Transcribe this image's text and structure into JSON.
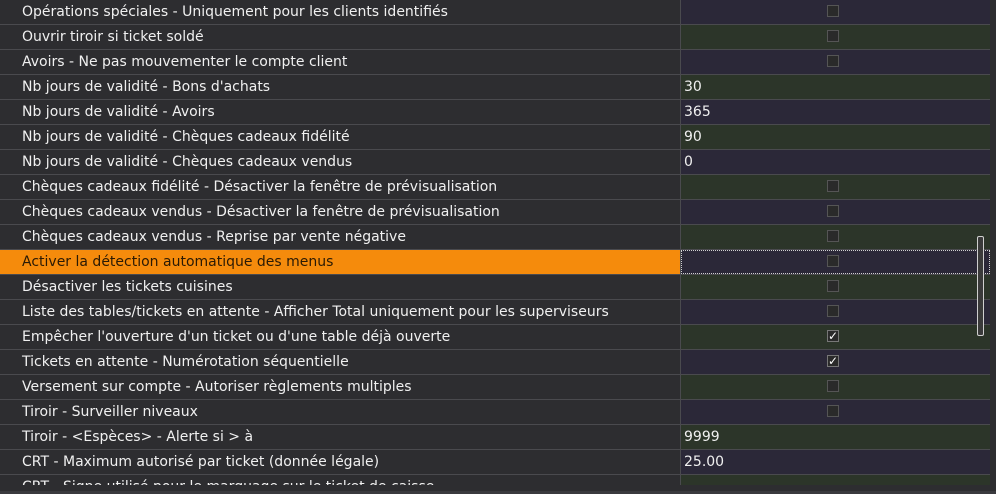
{
  "rows": [
    {
      "label": "Opérations spéciales - Uniquement pour les clients identifiés",
      "type": "checkbox",
      "checked": false,
      "value": ""
    },
    {
      "label": "Ouvrir tiroir si ticket soldé",
      "type": "checkbox",
      "checked": false,
      "value": ""
    },
    {
      "label": "Avoirs - Ne pas mouvementer le compte client",
      "type": "checkbox",
      "checked": false,
      "value": ""
    },
    {
      "label": "Nb jours de validité - Bons d'achats",
      "type": "text",
      "value": "30"
    },
    {
      "label": "Nb jours de validité - Avoirs",
      "type": "text",
      "value": "365"
    },
    {
      "label": "Nb jours de validité - Chèques cadeaux fidélité",
      "type": "text",
      "value": "90"
    },
    {
      "label": "Nb jours de validité - Chèques cadeaux vendus",
      "type": "text",
      "value": "0"
    },
    {
      "label": "Chèques cadeaux fidélité - Désactiver la fenêtre de prévisualisation",
      "type": "checkbox",
      "checked": false,
      "value": ""
    },
    {
      "label": "Chèques cadeaux vendus - Désactiver la fenêtre de prévisualisation",
      "type": "checkbox",
      "checked": false,
      "value": ""
    },
    {
      "label": "Chèques cadeaux vendus - Reprise par vente négative",
      "type": "checkbox",
      "checked": false,
      "value": ""
    },
    {
      "label": "Activer la détection automatique des menus",
      "type": "checkbox",
      "checked": false,
      "value": "",
      "selected": true
    },
    {
      "label": "Désactiver les tickets cuisines",
      "type": "checkbox",
      "checked": false,
      "value": ""
    },
    {
      "label": "Liste des tables/tickets en attente - Afficher Total uniquement pour les superviseurs",
      "type": "checkbox",
      "checked": false,
      "value": ""
    },
    {
      "label": "Empêcher l'ouverture d'un ticket ou d'une table déjà ouverte",
      "type": "checkbox",
      "checked": true,
      "value": "✓"
    },
    {
      "label": "Tickets en attente - Numérotation séquentielle",
      "type": "checkbox",
      "checked": true,
      "value": "✓"
    },
    {
      "label": "Versement sur compte - Autoriser règlements multiples",
      "type": "checkbox",
      "checked": false,
      "value": ""
    },
    {
      "label": "Tiroir - Surveiller niveaux",
      "type": "checkbox",
      "checked": false,
      "value": ""
    },
    {
      "label": "Tiroir - <Espèces> - Alerte si > à",
      "type": "text",
      "value": "9999"
    },
    {
      "label": "CRT - Maximum autorisé par ticket (donnée légale)",
      "type": "text",
      "value": "25.00"
    },
    {
      "label": "CRT - Signe utilisé pour le marquage sur le ticket de caisse",
      "type": "text",
      "value": "",
      "partial": true
    }
  ],
  "colors": {
    "label_bg": "#2d2d30",
    "value_purple": "#2b2838",
    "value_green": "#2c3529",
    "selected": "#f58b0c",
    "text": "#f0f0f0"
  },
  "icons": {
    "check": "check-icon"
  }
}
